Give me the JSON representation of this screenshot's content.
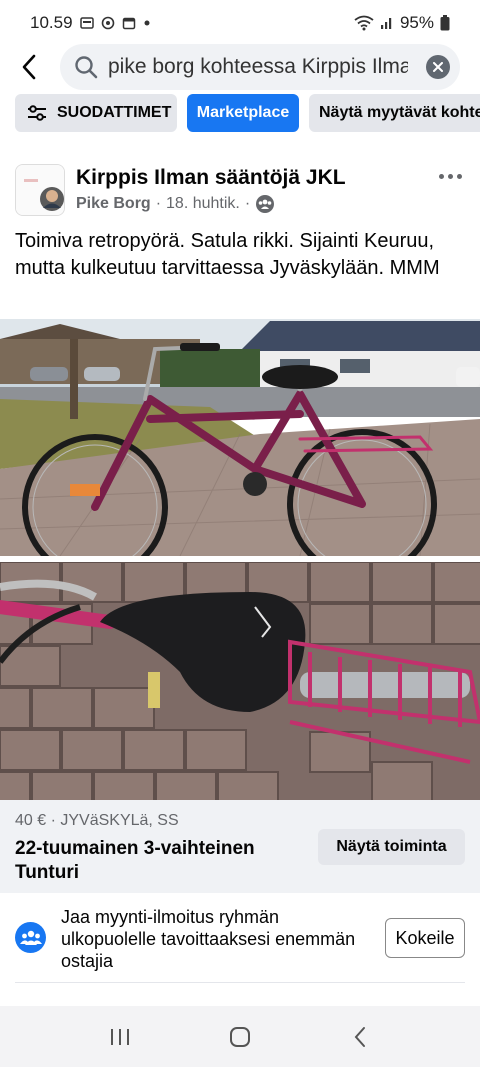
{
  "status_bar": {
    "time": "10.59",
    "battery": "95%",
    "icons": [
      "gallery-icon",
      "messenger-icon",
      "calendar-icon",
      "dot-icon",
      "wifi-icon",
      "signal-icon",
      "battery-icon"
    ]
  },
  "search": {
    "query": "pike borg kohteessa Kirppis Ilman"
  },
  "chips": {
    "filters_label": "SUODATTIMET",
    "marketplace_label": "Marketplace",
    "show_sold_label": "Näytä myytävät kohteet"
  },
  "post": {
    "group_name": "Kirppis Ilman sääntöjä JKL",
    "author": "Pike Borg",
    "date": "18. huhtik.",
    "separator": "·",
    "privacy_icon": "group-icon",
    "text": "Toimiva retropyörä. Satula rikki. Sijainti Keuruu, mutta kulkeutuu tarvittaessa Jyväskylään. MMM"
  },
  "listing": {
    "price_location": "40 € · JYVäSKYLä, SS",
    "title": "22-tuumainen 3-vaihteinen Tunturi",
    "action_label": "Näytä toiminta"
  },
  "share_prompt": {
    "text": "Jaa myynti-ilmoitus ryhmän ulkopuolelle tavoittaaksesi enemmän ostajia",
    "button_label": "Kokeile"
  },
  "colors": {
    "accent": "#1877f2",
    "bike_frame": "#7a1f4a",
    "basket": "#c2316d"
  }
}
